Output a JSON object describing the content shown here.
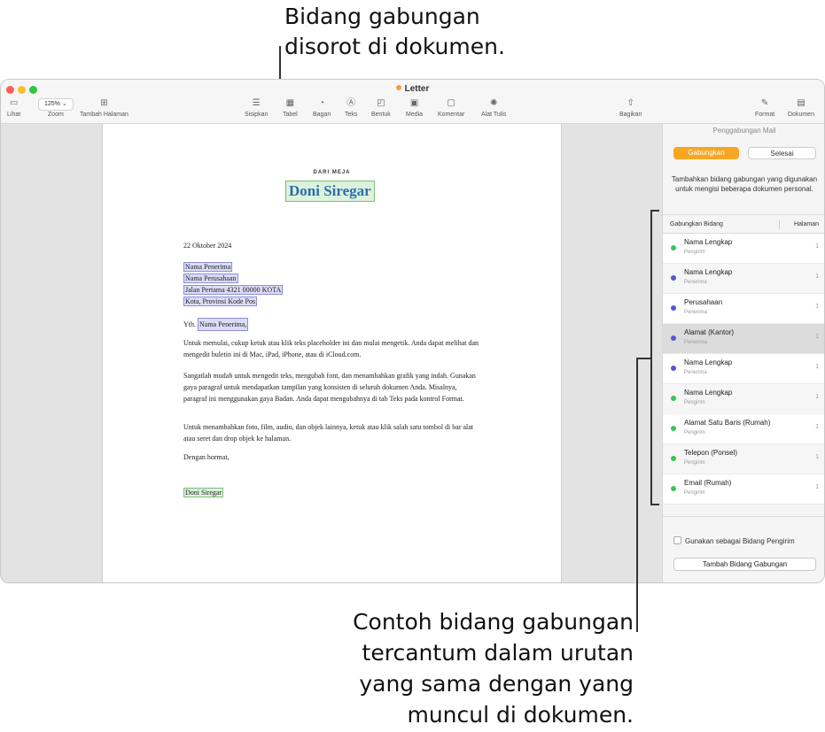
{
  "callouts": {
    "top": [
      "Bidang gabungan",
      "disorot di dokumen."
    ],
    "bottom": [
      "Contoh bidang gabungan",
      "tercantum dalam urutan",
      "yang sama dengan yang",
      "muncul di dokumen."
    ]
  },
  "window": {
    "title": "Letter",
    "title_dot_color": "#f0a23a"
  },
  "toolbar": {
    "view": "Lihat",
    "zoom_value": "125%",
    "zoom": "Zoom",
    "add_page": "Tambah Halaman",
    "insert": "Sisipkan",
    "table": "Tabel",
    "chart": "Bagan",
    "text": "Teks",
    "shape": "Bentuk",
    "media": "Media",
    "comment": "Komentar",
    "writing_tools": "Alat Tulis",
    "share": "Bagikan",
    "format": "Format",
    "document": "Dokumen"
  },
  "letter": {
    "from_label": "DARI MEJA",
    "sender_name": "Doni Siregar",
    "date": "22 Oktober 2024",
    "recipient_name": "Nama Penerima",
    "company": "Nama Perusahaan",
    "street": "Jalan Pertama 4321 00000 KOTA",
    "city": "Kota, Provinsi Kode Pos",
    "salutation_prefix": "Yth.",
    "salutation_field": "Nama Penerima,",
    "para1": "Untuk memulai, cukup ketuk atau klik teks placeholder ini dan mulai mengetik. Anda dapat melihat dan mengedit buletin ini di Mac, iPad, iPhone, atau di iCloud.com.",
    "para2": "Sangatlah mudah untuk mengedit teks, mengubah font, dan menambahkan grafik yang indah. Gunakan gaya paragraf untuk mendapatkan tampilan yang konsisten di seluruh dokumen Anda. Misalnya, paragraf ini menggunakan gaya Badan. Anda dapat mengubahnya di tab Teks pada kontrol Format.",
    "para3": "Untuk menambahkan foto, film, audio, dan objek lainnya, ketuk atau klik salah satu tombol di bar alat atau seret dan drop objek ke halaman.",
    "closing": "Dengan hormat,",
    "signature": "Doni Siregar"
  },
  "sidebar": {
    "title": "Penggabungan Mail",
    "merge_button": "Gabungkan",
    "done_button": "Selesai",
    "description": "Tambahkan bidang gabungan yang digunakan untuk mengisi beberapa dokumen personal.",
    "col_field": "Gabungkan Bidang",
    "col_page": "Halaman",
    "fields": [
      {
        "name": "Nama Lengkap",
        "source": "Pengirim",
        "page": "1",
        "color": "#35c759"
      },
      {
        "name": "Nama Lengkap",
        "source": "Penerima",
        "page": "1",
        "color": "#5856d6"
      },
      {
        "name": "Perusahaan",
        "source": "Penerima",
        "page": "1",
        "color": "#5856d6"
      },
      {
        "name": "Alamat (Kantor)",
        "source": "Penerima",
        "page": "1",
        "color": "#5856d6"
      },
      {
        "name": "Nama Lengkap",
        "source": "Penerima",
        "page": "1",
        "color": "#5856d6"
      },
      {
        "name": "Nama Lengkap",
        "source": "Pengirim",
        "page": "1",
        "color": "#35c759"
      },
      {
        "name": "Alamat Satu Baris (Rumah)",
        "source": "Pengirim",
        "page": "1",
        "color": "#35c759"
      },
      {
        "name": "Telepon (Ponsel)",
        "source": "Pengirim",
        "page": "1",
        "color": "#35c759"
      },
      {
        "name": "Email (Rumah)",
        "source": "Pengirim",
        "page": "1",
        "color": "#35c759"
      }
    ],
    "use_as_sender": "Gunakan sebagai Bidang Pengirim",
    "add_field_button": "Tambah Bidang Gabungan"
  }
}
